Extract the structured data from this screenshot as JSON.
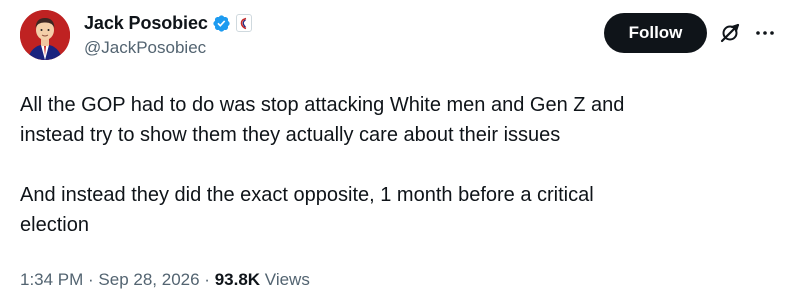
{
  "author": {
    "display_name": "Jack Posobiec",
    "handle": "@JackPosobiec",
    "verified": true
  },
  "actions": {
    "follow_label": "Follow",
    "grok_icon": "grok-icon",
    "more_icon": "more-icon"
  },
  "tweet": {
    "text": "All the GOP had to do was stop attacking White men and Gen Z and\ninstead try to show them they actually care about their issues\n\nAnd instead they did the exact opposite, 1 month before a critical\nelection",
    "time": "1:34 PM",
    "separator": " · ",
    "date": "Sep 28, 2026",
    "views_count": "93.8K",
    "views_label": "Views"
  },
  "colors": {
    "text_primary": "#0f1419",
    "text_secondary": "#536471",
    "verified_blue": "#1d9bf0",
    "button_bg": "#0f1419"
  }
}
